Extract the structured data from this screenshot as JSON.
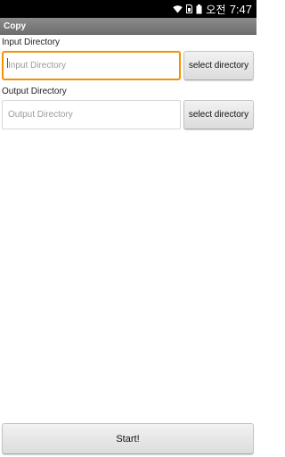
{
  "status_bar": {
    "time_prefix": "오전",
    "time": "7:47",
    "icons": [
      "wifi-icon",
      "sim-icon",
      "battery-icon"
    ]
  },
  "app": {
    "title": "Copy"
  },
  "input": {
    "label": "Input Directory",
    "placeholder": "Input Directory",
    "value": "",
    "button_label": "select directory"
  },
  "output": {
    "label": "Output Directory",
    "placeholder": "Output Directory",
    "value": "",
    "button_label": "select directory"
  },
  "start_button": {
    "label": "Start!"
  },
  "colors": {
    "focus_accent": "#f39200",
    "title_bar": "#7d7d7d",
    "status_bar": "#000000"
  }
}
